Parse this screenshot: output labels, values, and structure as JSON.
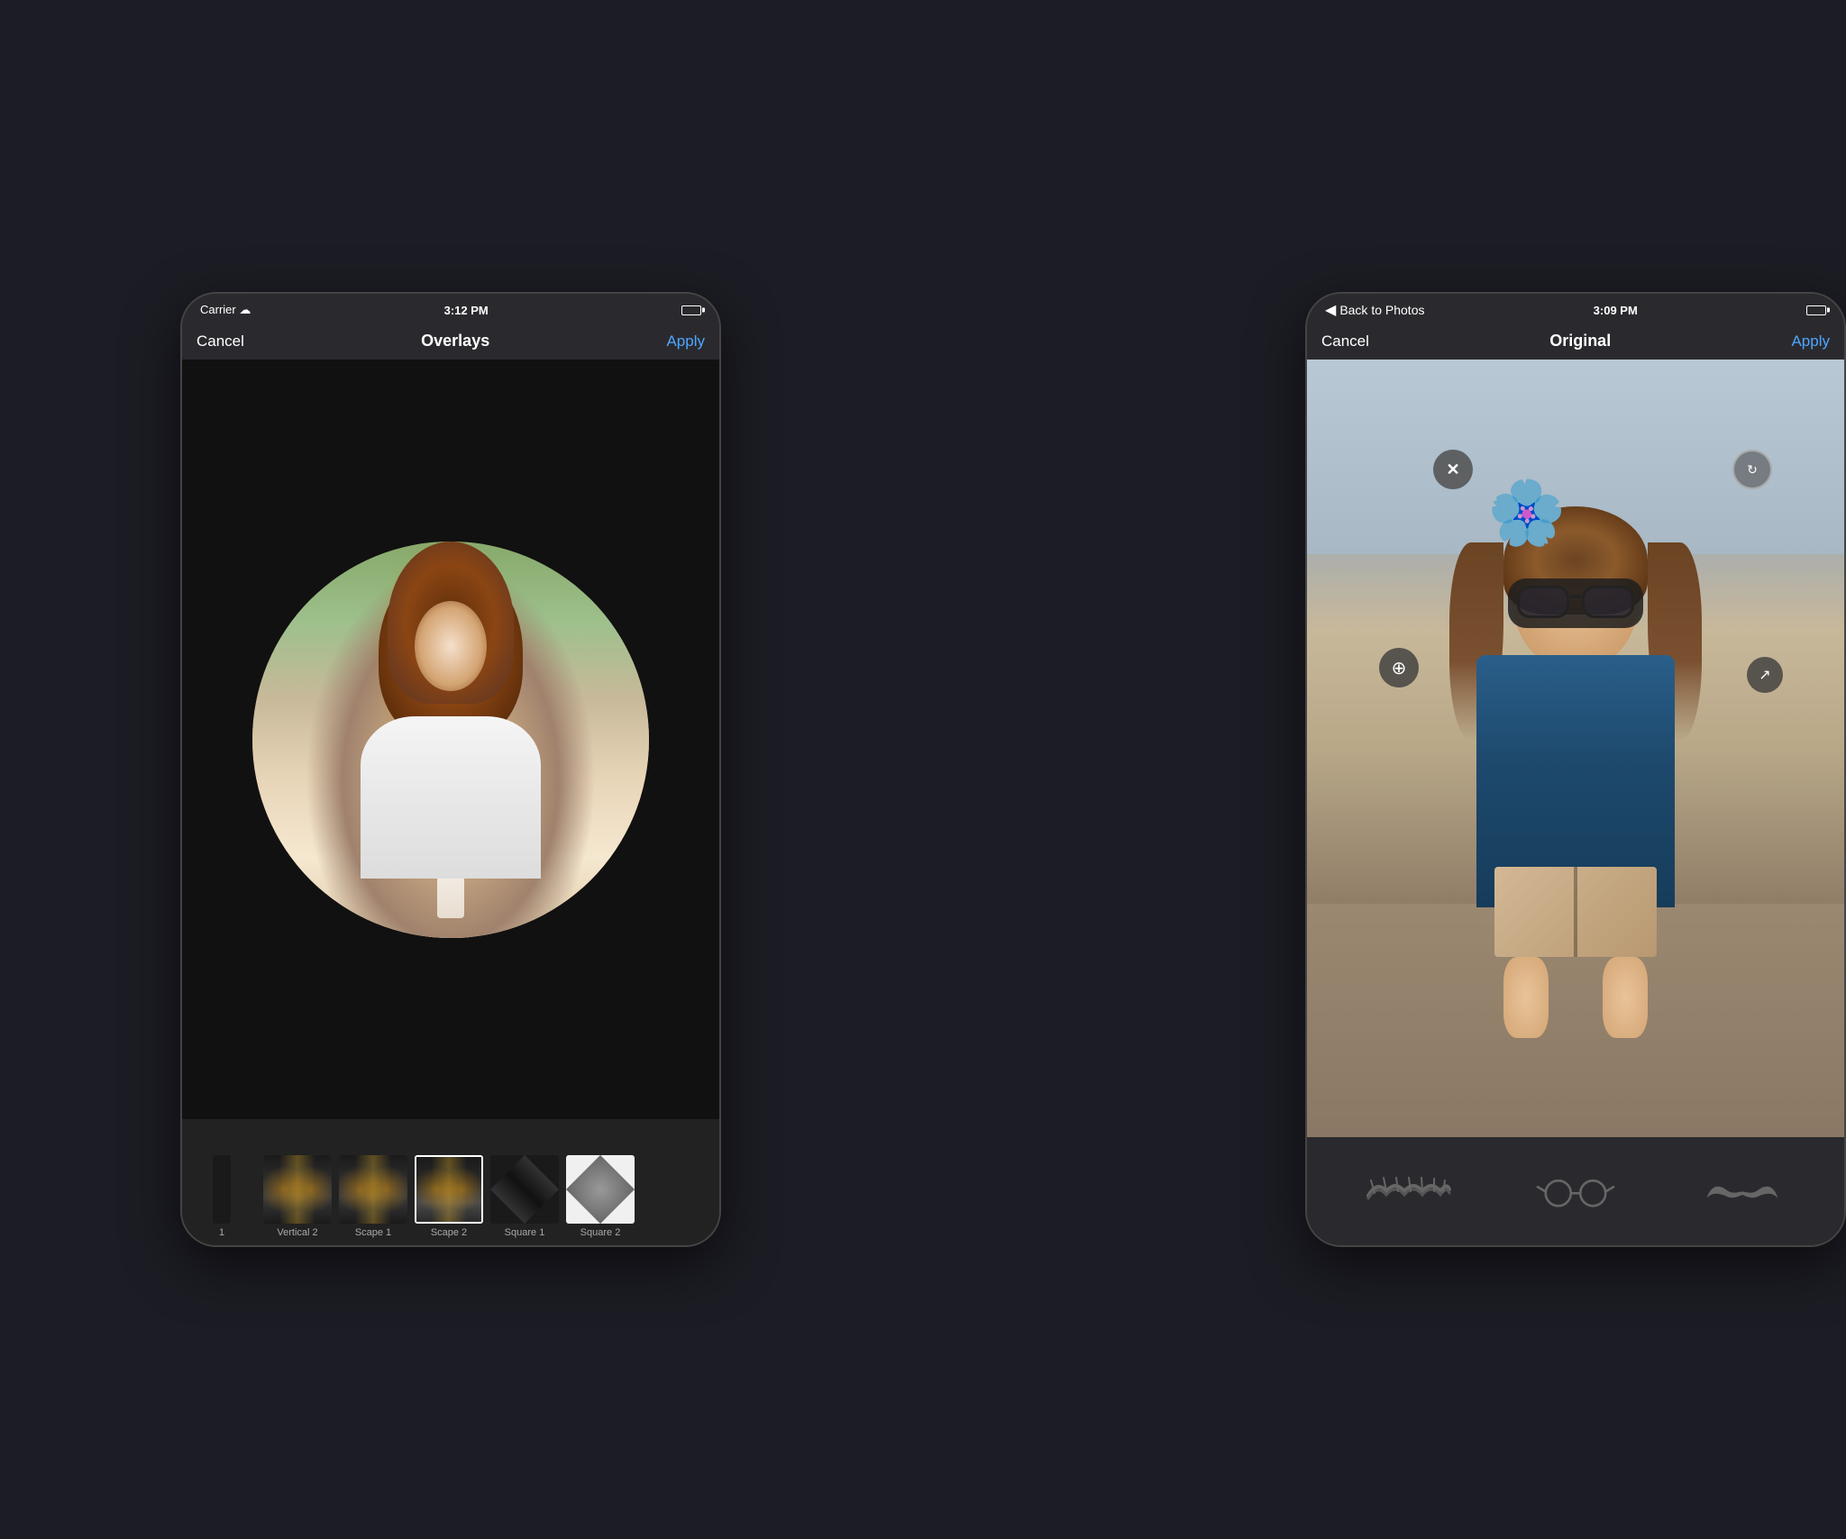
{
  "left_phone": {
    "status_bar": {
      "carrier": "Carrier",
      "wifi": "📶",
      "time": "3:12 PM",
      "battery_full": true
    },
    "nav": {
      "cancel": "Cancel",
      "title": "Overlays",
      "apply": "Apply"
    },
    "thumbnails": [
      {
        "label": "1",
        "id": "thumb-1",
        "selected": false,
        "type": "first"
      },
      {
        "label": "Vertical 2",
        "id": "thumb-vertical2",
        "selected": false,
        "type": "road"
      },
      {
        "label": "Scape 1",
        "id": "thumb-scape1",
        "selected": false,
        "type": "road"
      },
      {
        "label": "Scape 2",
        "id": "thumb-scape2",
        "selected": true,
        "type": "road"
      },
      {
        "label": "Square 1",
        "id": "thumb-square1",
        "selected": false,
        "type": "square"
      },
      {
        "label": "Square 2",
        "id": "thumb-square2",
        "selected": false,
        "type": "square"
      }
    ]
  },
  "right_phone": {
    "status_bar": {
      "back": "Back to Photos",
      "time": "3:09 PM",
      "battery_full": true
    },
    "nav": {
      "cancel": "Cancel",
      "title": "Original",
      "apply": "Apply"
    },
    "stickers": {
      "close_icon": "✕",
      "rotate_icon": "↻",
      "add_icon": "◉",
      "resize_icon": "↗"
    },
    "toolbar_icons": {
      "eyelash": "eyelash",
      "glasses": "glasses",
      "mustache": "mustache"
    }
  },
  "colors": {
    "accent_blue": "#4da6ff",
    "bg_dark": "#2a2a2e",
    "text_white": "#ffffff",
    "text_gray": "#aaaaaa"
  }
}
